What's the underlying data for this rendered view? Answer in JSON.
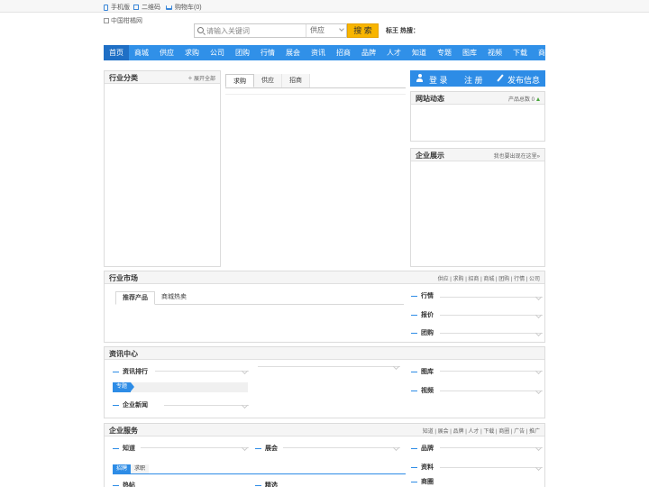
{
  "topbar": {
    "mobile": "手机版",
    "qrcode": "二维码",
    "cart": "购物车(0)"
  },
  "logo": {
    "alt": "中国柑橘网"
  },
  "search": {
    "placeholder": "请输入关键词",
    "category": "供应",
    "button": "搜 索",
    "hot_label": "标王 热搜："
  },
  "nav": [
    "首页",
    "商城",
    "供应",
    "求购",
    "公司",
    "团购",
    "行情",
    "展会",
    "资讯",
    "招商",
    "品牌",
    "人才",
    "知道",
    "专题",
    "图库",
    "视频",
    "下载",
    "商圈"
  ],
  "category_panel": {
    "title": "行业分类",
    "expand": "展开全部"
  },
  "mid_tabs": [
    "求购",
    "供应",
    "招商"
  ],
  "account": {
    "login": "登 录",
    "register": "注 册",
    "publish": "发布信息"
  },
  "dynamics": {
    "title": "网站动态",
    "right": "产品总数 0"
  },
  "enterprise": {
    "title": "企业展示",
    "right": "我也要出现在这里»"
  },
  "market": {
    "title": "行业市场",
    "links": "供应 | 求购 | 招商 | 商城 | 团购 | 行情 | 公司",
    "tabs": [
      "推荐产品",
      "商城热卖"
    ],
    "side": [
      "行情",
      "报价",
      "团购"
    ]
  },
  "news": {
    "title": "资讯中心",
    "ranking": "资讯排行",
    "topic": "专题",
    "company_news": "企业新闻",
    "side": [
      "图库",
      "视频"
    ]
  },
  "service": {
    "title": "企业服务",
    "links": "知道 | 展会 | 品牌 | 人才 | 下载 | 商圈 | 广告 | 推广",
    "left": [
      "知道",
      "展会"
    ],
    "job_tabs": [
      "招聘",
      "求职"
    ],
    "bottom": [
      "热帖",
      "精选"
    ],
    "side": [
      "品牌",
      "资料",
      "商圈"
    ]
  }
}
